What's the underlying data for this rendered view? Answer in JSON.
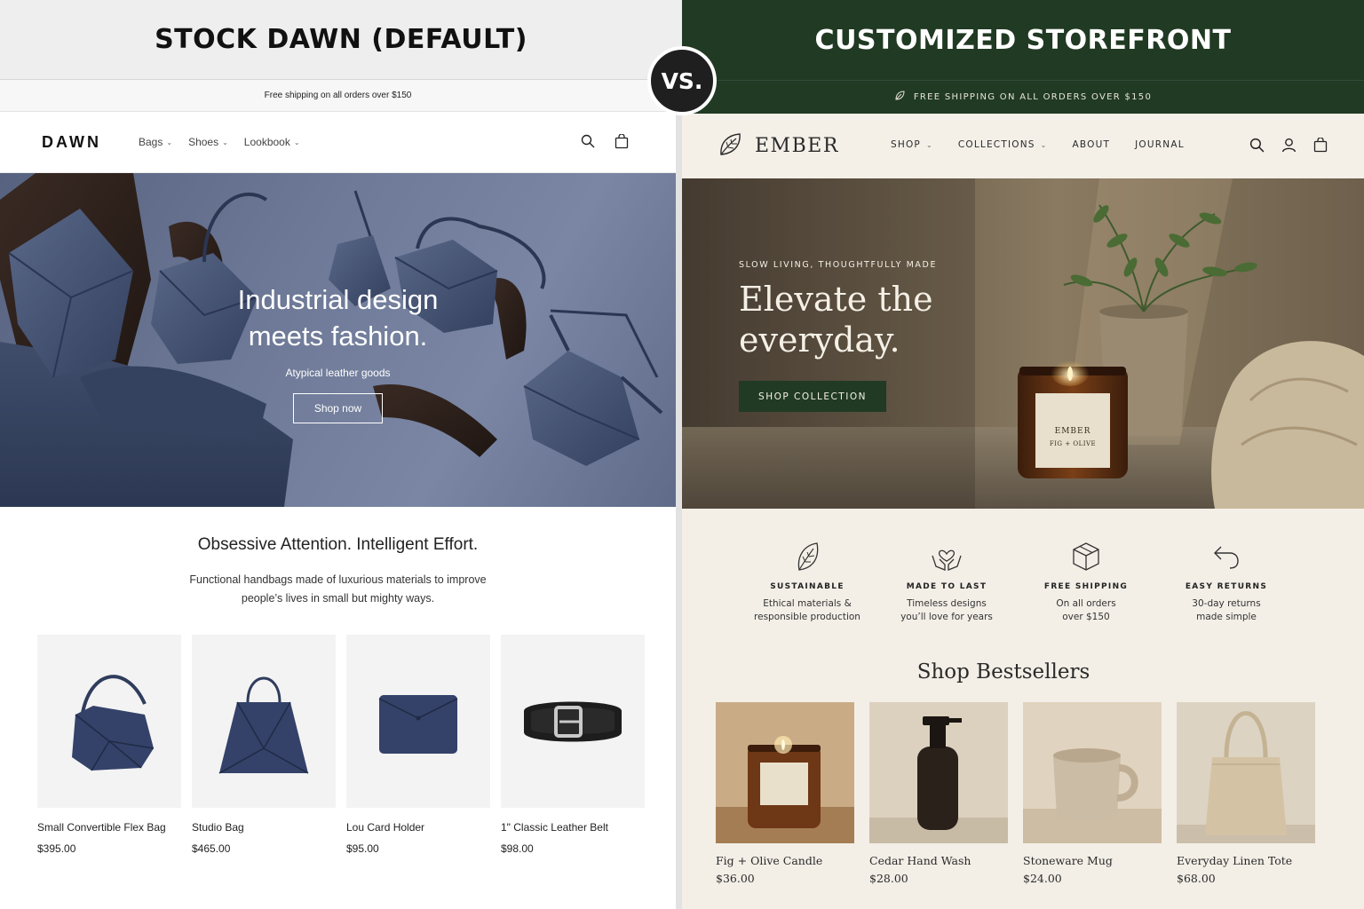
{
  "comparison": {
    "left_header": "STOCK DAWN (DEFAULT)",
    "right_header": "CUSTOMIZED STOREFRONT",
    "vs_label": "VS."
  },
  "dawn": {
    "announcement": "Free shipping on all orders over $150",
    "logo": "DAWN",
    "menu": [
      {
        "label": "Bags"
      },
      {
        "label": "Shoes"
      },
      {
        "label": "Lookbook"
      }
    ],
    "icons": [
      "search-icon",
      "cart-icon"
    ],
    "hero": {
      "title_line1": "Industrial design",
      "title_line2": "meets fashion.",
      "subtitle": "Atypical leather goods",
      "button": "Shop now"
    },
    "intro": {
      "title": "Obsessive Attention. Intelligent Effort.",
      "text": "Functional handbags made of luxurious materials to improve people’s lives in small but mighty ways."
    },
    "products": [
      {
        "name": "Small Convertible Flex Bag",
        "price": "$395.00"
      },
      {
        "name": "Studio Bag",
        "price": "$465.00"
      },
      {
        "name": "Lou Card Holder",
        "price": "$95.00"
      },
      {
        "name": "1\" Classic Leather Belt",
        "price": "$98.00"
      }
    ],
    "colors": {
      "hero_bg": "#6d7996",
      "product_navy": "#2f3c5c"
    }
  },
  "ember": {
    "announcement": "FREE SHIPPING ON ALL ORDERS OVER $150",
    "logo": "EMBER",
    "menu": [
      {
        "label": "SHOP",
        "has_dropdown": true
      },
      {
        "label": "COLLECTIONS",
        "has_dropdown": true
      },
      {
        "label": "ABOUT",
        "has_dropdown": false
      },
      {
        "label": "JOURNAL",
        "has_dropdown": false
      }
    ],
    "icons": [
      "search-icon",
      "account-icon",
      "cart-icon"
    ],
    "hero": {
      "eyebrow": "SLOW LIVING, THOUGHTFULLY MADE",
      "title_line1": "Elevate the",
      "title_line2": "everyday.",
      "button": "SHOP COLLECTION",
      "candle_label_brand": "EMBER",
      "candle_label_scent": "FIG + OLIVE"
    },
    "features": [
      {
        "icon": "leaf-icon",
        "title": "SUSTAINABLE",
        "line1": "Ethical materials &",
        "line2": "responsible production"
      },
      {
        "icon": "heart-hands-icon",
        "title": "MADE TO LAST",
        "line1": "Timeless designs",
        "line2": "you’ll love for years"
      },
      {
        "icon": "box-icon",
        "title": "FREE SHIPPING",
        "line1": "On all orders",
        "line2": "over $150"
      },
      {
        "icon": "return-arrow-icon",
        "title": "EASY RETURNS",
        "line1": "30-day returns",
        "line2": "made simple"
      }
    ],
    "section_title": "Shop Bestsellers",
    "products": [
      {
        "name": "Fig + Olive Candle",
        "price": "$36.00"
      },
      {
        "name": "Cedar Hand Wash",
        "price": "$28.00"
      },
      {
        "name": "Stoneware Mug",
        "price": "$24.00"
      },
      {
        "name": "Everyday Linen Tote",
        "price": "$68.00"
      }
    ],
    "colors": {
      "brand_green": "#213a23",
      "cream": "#f3efe7"
    }
  }
}
